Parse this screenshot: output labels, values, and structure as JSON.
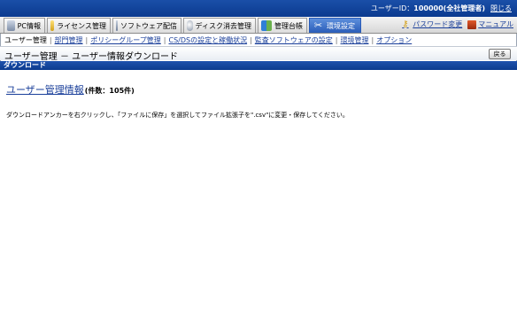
{
  "topbar": {
    "user_label": "ユーザーID：",
    "user_value": "100000(全社管理者)",
    "logout": "閉じる"
  },
  "tabs": [
    {
      "label": "PC情報",
      "icon": "pc-icon"
    },
    {
      "label": "ライセンス管理",
      "icon": "license-icon"
    },
    {
      "label": "ソフトウェア配信",
      "icon": "software-icon"
    },
    {
      "label": "ディスク消去管理",
      "icon": "disk-icon"
    },
    {
      "label": "管理台帳",
      "icon": "ledger-icon"
    },
    {
      "label": "環境設定",
      "icon": "settings-icon",
      "active": true
    }
  ],
  "right_links": {
    "password": "パスワード変更",
    "manual": "マニュアル"
  },
  "subnav": {
    "current": "ユーザー管理",
    "links": [
      "部門管理",
      "ポリシーグループ管理",
      "CS/DSの設定と稼働状況",
      "監査ソフトウェアの設定",
      "環境管理",
      "オプション"
    ]
  },
  "page": {
    "title": "ユーザー管理 － ユーザー情報ダウンロード",
    "back_button": "戻る",
    "section_header": "ダウンロード",
    "download_link": "ユーザー管理情報",
    "count_text": "(件数：105件)",
    "note": "ダウンロードアンカーを右クリックし、「ファイルに保存」を選択してファイル拡張子を\".csv\"に変更・保存してください。"
  }
}
